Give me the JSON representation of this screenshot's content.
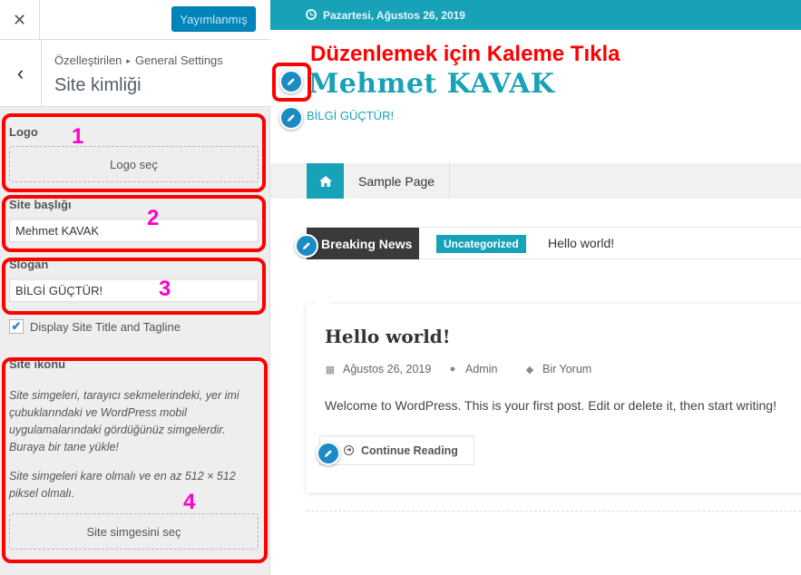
{
  "colors": {
    "accent": "#17a2b8",
    "publish": "#0085ba",
    "annotation_red": "#ff0000",
    "annotation_number": "#ff00cc",
    "edit_pen": "#1c8bc4"
  },
  "header": {
    "close_icon": "close-icon",
    "publish_label": "Yayımlanmış"
  },
  "section": {
    "breadcrumb_root": "Özelleştirilen",
    "breadcrumb_sep": "▸",
    "breadcrumb_current": "General Settings",
    "title": "Site kimliği",
    "back_icon": "chevron-left-icon"
  },
  "controls": {
    "logo_label": "Logo",
    "logo_button": "Logo seç",
    "site_title_label": "Site başlığı",
    "site_title_value": "Mehmet KAVAK",
    "tagline_label": "Slogan",
    "tagline_value": "BİLGİ GÜÇTÜR!",
    "display_checkbox_label": "Display Site Title and Tagline",
    "display_checked": true,
    "site_icon_label": "Site ikonu",
    "site_icon_desc1": "Site simgeleri, tarayıcı sekmelerindeki, yer imi çubuklarındaki ve WordPress mobil uygulamalarındaki gördüğünüz simgelerdir. Buraya bir tane yükle!",
    "site_icon_desc2": "Site simgeleri kare olmalı ve en az 512 × 512 piksel olmalı.",
    "site_icon_button": "Site simgesini seç"
  },
  "annotations": {
    "numbers": [
      "1",
      "2",
      "3",
      "4"
    ],
    "instruction": "Düzenlemek için Kaleme Tıkla"
  },
  "preview": {
    "date": "Pazartesi, Ağustos 26, 2019",
    "site_title": "Mehmet KAVAK",
    "tagline": "BİLGİ GÜÇTÜR!",
    "nav": {
      "home_icon": "home-icon",
      "items": [
        "Sample Page"
      ]
    },
    "breaking_news": {
      "label": "Breaking News",
      "category": "Uncategorized",
      "headline": "Hello world!"
    },
    "post": {
      "title": "Hello world!",
      "date": "Ağustos 26, 2019",
      "author": "Admin",
      "comments": "Bir Yorum",
      "excerpt": "Welcome to WordPress. This is your first post. Edit or delete it, then start writing!",
      "read_more": "Continue Reading"
    }
  }
}
